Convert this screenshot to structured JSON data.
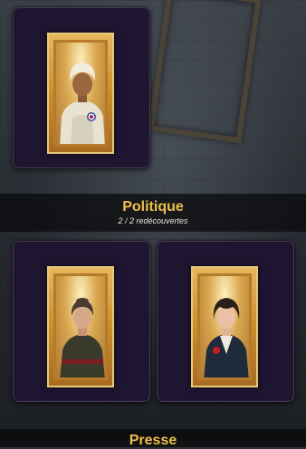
{
  "sections": [
    {
      "title": "Politique",
      "subtitle": "2 / 2 redécouvertes"
    },
    {
      "title": "Presse"
    }
  ],
  "cards": [
    {
      "icon": "portrait-woman-headwrap-rosette"
    },
    {
      "icon": "portrait-woman-dark-dress"
    },
    {
      "icon": "portrait-woman-suit-red-flower"
    }
  ],
  "colors": {
    "title": "#f0bf4a",
    "card_bg": "#1e1530",
    "frame_gold": "#e6b75c"
  }
}
